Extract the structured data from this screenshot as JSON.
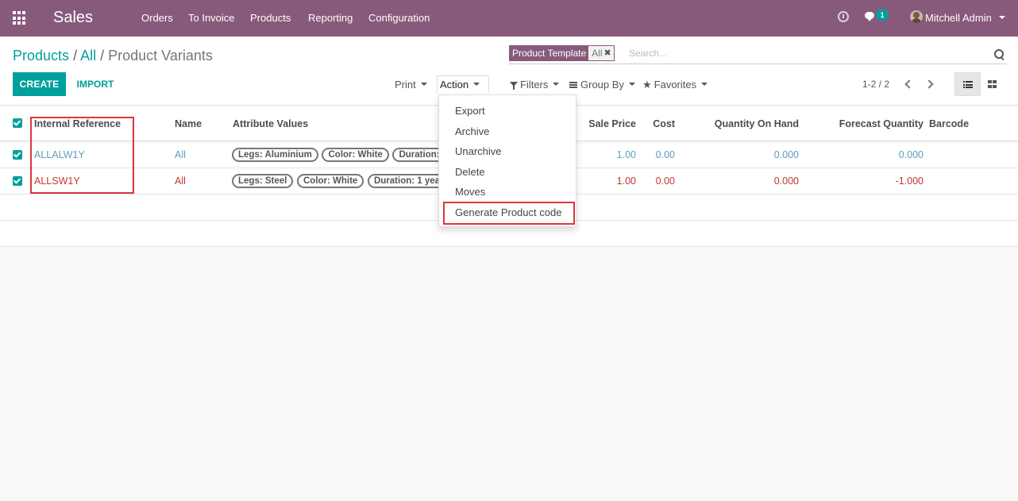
{
  "navbar": {
    "app_title": "Sales",
    "menu": [
      "Orders",
      "To Invoice",
      "Products",
      "Reporting",
      "Configuration"
    ],
    "chat_count": "1",
    "user_name": "Mitchell Admin",
    "brand_color": "#875a7b"
  },
  "breadcrumb": {
    "items": [
      "Products",
      "All"
    ],
    "current": "Product Variants"
  },
  "search": {
    "facet_label": "Product Template",
    "facet_value": "All",
    "placeholder": "Search..."
  },
  "toolbar": {
    "create_label": "CREATE",
    "import_label": "IMPORT",
    "print_label": "Print",
    "action_label": "Action",
    "filters_label": "Filters",
    "groupby_label": "Group By",
    "favorites_label": "Favorites",
    "pager": "1-2 / 2"
  },
  "action_menu": {
    "items": [
      "Export",
      "Archive",
      "Unarchive",
      "Delete",
      "Moves",
      "Generate Product code"
    ]
  },
  "table": {
    "headers": {
      "internal_reference": "Internal Reference",
      "name": "Name",
      "attribute_values": "Attribute Values",
      "sale_price": "Sale Price",
      "cost": "Cost",
      "qty_on_hand": "Quantity On Hand",
      "forecast_qty": "Forecast Quantity",
      "barcode": "Barcode"
    },
    "rows": [
      {
        "ref": "ALLALW1Y",
        "name": "All",
        "tags": [
          "Legs: Aluminium",
          "Color: White",
          "Duration: 1 year"
        ],
        "sale_price": "1.00",
        "cost": "0.00",
        "qty_on_hand": "0.000",
        "forecast_qty": "0.000",
        "barcode": ""
      },
      {
        "ref": "ALLSW1Y",
        "name": "All",
        "tags": [
          "Legs: Steel",
          "Color: White",
          "Duration: 1 year"
        ],
        "sale_price": "1.00",
        "cost": "0.00",
        "qty_on_hand": "0.000",
        "forecast_qty": "-1.000",
        "barcode": ""
      }
    ]
  },
  "colors": {
    "primary": "#00a09d",
    "highlight": "#d9363e",
    "link_teal": "#5ba0ba",
    "negative_red": "#c0392b"
  }
}
